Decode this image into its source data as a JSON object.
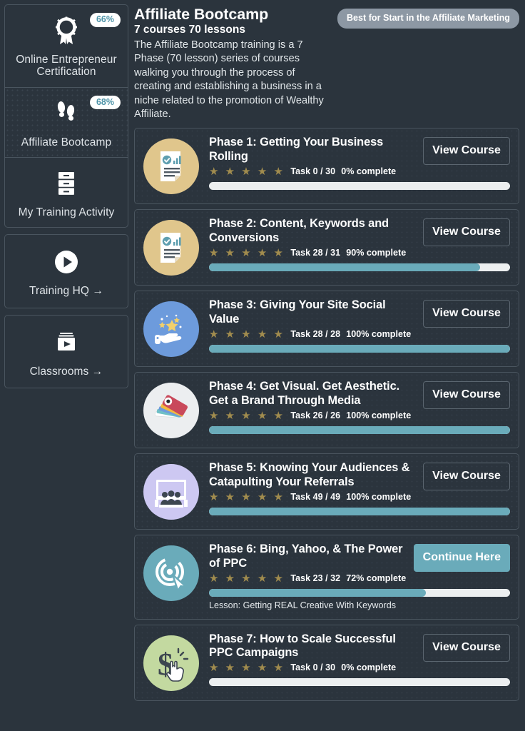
{
  "sidebar": {
    "items": [
      {
        "label": "Online Entrepreneur Certification",
        "percent": "66%",
        "icon": "award-ribbon-icon",
        "active": false,
        "grouped": true
      },
      {
        "label": "Affiliate Bootcamp",
        "percent": "68%",
        "icon": "footsteps-icon",
        "active": true,
        "grouped": true
      },
      {
        "label": "My Training Activity",
        "percent": null,
        "icon": "drawers-icon",
        "active": false,
        "grouped": true
      },
      {
        "label": "Training HQ →",
        "percent": null,
        "icon": "play-circle-icon",
        "active": false,
        "grouped": false
      },
      {
        "label": "Classrooms →",
        "percent": null,
        "icon": "video-folder-icon",
        "active": false,
        "grouped": false
      }
    ]
  },
  "header": {
    "title": "Affiliate Bootcamp",
    "subtitle": "7 courses 70 lessons",
    "description": "The Affiliate Bootcamp training is a 7 Phase (70 lesson) series of courses walking you through the process of creating and establishing a business in a niche related to the promotion of Wealthy Affiliate.",
    "badge": "Best for Start in the Affiliate Marketing"
  },
  "colors": {
    "accent_teal": "#6aabba",
    "star_gold": "#a18c4e",
    "background": "#2b343d",
    "card_border": "#4a555f",
    "badge_gray": "#8d98a4"
  },
  "courses": [
    {
      "title": "Phase 1: Getting Your Business Rolling",
      "stars": "★ ★ ★ ★ ★",
      "task": "Task 0 / 30",
      "percent_label": "0% complete",
      "percent_value": 0,
      "button": "View Course",
      "button_style": "outline",
      "icon": "document-chart-icon",
      "lesson": null
    },
    {
      "title": "Phase 2: Content, Keywords and Conversions",
      "stars": "★ ★ ★ ★ ★",
      "task": "Task 28 / 31",
      "percent_label": "90% complete",
      "percent_value": 90,
      "button": "View Course",
      "button_style": "outline",
      "icon": "document-chart-icon",
      "lesson": null
    },
    {
      "title": "Phase 3: Giving Your Site Social Value",
      "stars": "★ ★ ★ ★ ★",
      "task": "Task 28 / 28",
      "percent_label": "100% complete",
      "percent_value": 100,
      "button": "View Course",
      "button_style": "outline",
      "icon": "hand-stars-icon",
      "lesson": null
    },
    {
      "title": "Phase 4: Get Visual.  Get Aesthetic. Get a Brand Through Media",
      "stars": "★ ★ ★ ★ ★",
      "task": "Task 26 / 26",
      "percent_label": "100% complete",
      "percent_value": 100,
      "button": "View Course",
      "button_style": "outline",
      "icon": "color-swatch-icon",
      "lesson": null
    },
    {
      "title": "Phase 5: Knowing Your Audiences & Catapulting Your Referrals",
      "stars": "★ ★ ★ ★ ★",
      "task": "Task 49 / 49",
      "percent_label": "100% complete",
      "percent_value": 100,
      "button": "View Course",
      "button_style": "outline",
      "icon": "audience-presentation-icon",
      "lesson": null
    },
    {
      "title": "Phase 6: Bing, Yahoo, & The Power of PPC",
      "stars": "★ ★ ★ ★ ★",
      "task": "Task 23 / 32",
      "percent_label": "72% complete",
      "percent_value": 72,
      "button": "Continue Here",
      "button_style": "primary",
      "icon": "target-cursor-icon",
      "lesson": "Lesson: Getting REAL Creative With Keywords"
    },
    {
      "title": "Phase 7: How to Scale Successful PPC Campaigns",
      "stars": "★ ★ ★ ★ ★",
      "task": "Task 0 / 30",
      "percent_label": "0% complete",
      "percent_value": 0,
      "button": "View Course",
      "button_style": "outline",
      "icon": "dollar-click-icon",
      "lesson": null
    }
  ]
}
